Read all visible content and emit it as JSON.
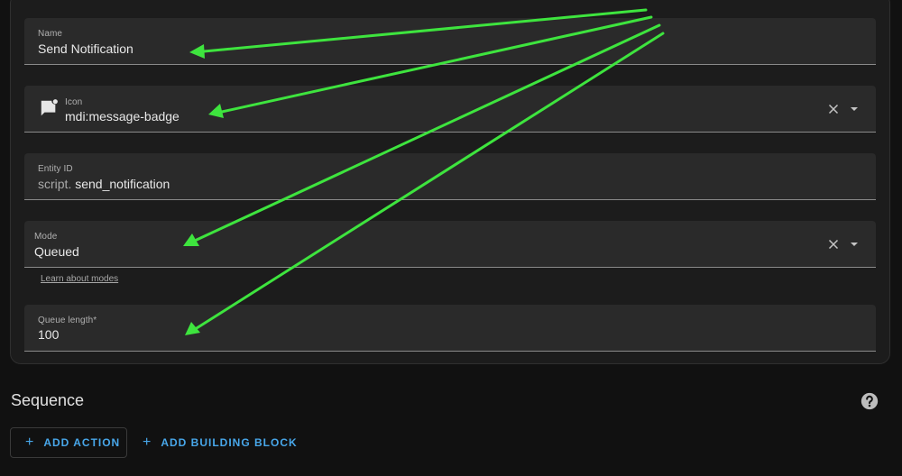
{
  "form": {
    "name": {
      "label": "Name",
      "value": "Send Notification"
    },
    "icon": {
      "label": "Icon",
      "value": "mdi:message-badge",
      "icon": "message-badge-icon"
    },
    "entity_id": {
      "label": "Entity ID",
      "prefix": "script.",
      "value": "send_notification"
    },
    "mode": {
      "label": "Mode",
      "value": "Queued",
      "helper_link": "Learn about modes"
    },
    "queue_length": {
      "label": "Queue length*",
      "value": "100"
    }
  },
  "sequence": {
    "title": "Sequence",
    "add_action_label": "ADD ACTION",
    "add_building_block_label": "ADD BUILDING BLOCK"
  },
  "colors": {
    "background": "#111111",
    "card": "#1c1c1c",
    "field": "#2a2a2a",
    "accent": "#48a7ea",
    "annotation_arrow": "#3ee43e"
  }
}
